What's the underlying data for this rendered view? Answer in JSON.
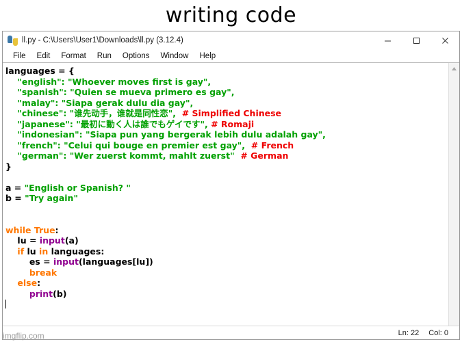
{
  "meme": {
    "caption": "writing code",
    "watermark": "imgflip.com"
  },
  "window": {
    "title": "ll.py - C:\\Users\\User1\\Downloads\\ll.py (3.12.4)",
    "icon": "python-idle-icon",
    "controls": {
      "minimize": "minimize-icon",
      "maximize": "maximize-icon",
      "close": "close-icon"
    }
  },
  "menubar": {
    "items": [
      {
        "label": "File"
      },
      {
        "label": "Edit"
      },
      {
        "label": "Format"
      },
      {
        "label": "Run"
      },
      {
        "label": "Options"
      },
      {
        "label": "Window"
      },
      {
        "label": "Help"
      }
    ]
  },
  "editor": {
    "lines": [
      {
        "indent": 0,
        "segments": [
          {
            "t": "languages = {",
            "c": "def"
          }
        ]
      },
      {
        "indent": 4,
        "segments": [
          {
            "t": "\"english\": \"Whoever moves first is gay\",",
            "c": "str"
          }
        ]
      },
      {
        "indent": 4,
        "segments": [
          {
            "t": "\"spanish\": \"Quien se mueva primero es gay\",",
            "c": "str"
          }
        ]
      },
      {
        "indent": 4,
        "segments": [
          {
            "t": "\"malay\": \"Siapa gerak dulu dia gay\",",
            "c": "str"
          }
        ]
      },
      {
        "indent": 4,
        "segments": [
          {
            "t": "\"chinese\": \"谁先动手，谁就是同性恋\",",
            "c": "str"
          },
          {
            "t": "  ",
            "c": "def"
          },
          {
            "t": "# Simplified Chinese",
            "c": "cmt"
          }
        ]
      },
      {
        "indent": 4,
        "segments": [
          {
            "t": "\"japanese\": \"最初に動く人は誰でもゲイです\",",
            "c": "str"
          },
          {
            "t": " ",
            "c": "def"
          },
          {
            "t": "# Romaji",
            "c": "cmt"
          }
        ]
      },
      {
        "indent": 4,
        "segments": [
          {
            "t": "\"indonesian\": \"Siapa pun yang bergerak lebih dulu adalah gay\",",
            "c": "str"
          }
        ]
      },
      {
        "indent": 4,
        "segments": [
          {
            "t": "\"french\": \"Celui qui bouge en premier est gay\",",
            "c": "str"
          },
          {
            "t": "  ",
            "c": "def"
          },
          {
            "t": "# French",
            "c": "cmt"
          }
        ]
      },
      {
        "indent": 4,
        "segments": [
          {
            "t": "\"german\": \"Wer zuerst kommt, mahlt zuerst\"",
            "c": "str"
          },
          {
            "t": "  ",
            "c": "def"
          },
          {
            "t": "# German",
            "c": "cmt"
          }
        ]
      },
      {
        "indent": 0,
        "segments": [
          {
            "t": "}",
            "c": "def"
          }
        ]
      },
      {
        "indent": 0,
        "segments": []
      },
      {
        "indent": 0,
        "segments": [
          {
            "t": "a = ",
            "c": "def"
          },
          {
            "t": "\"English or Spanish? \"",
            "c": "str"
          }
        ]
      },
      {
        "indent": 0,
        "segments": [
          {
            "t": "b = ",
            "c": "def"
          },
          {
            "t": "\"Try again\"",
            "c": "str"
          }
        ]
      },
      {
        "indent": 0,
        "segments": []
      },
      {
        "indent": 0,
        "segments": []
      },
      {
        "indent": 0,
        "segments": [
          {
            "t": "while True",
            "c": "kw"
          },
          {
            "t": ":",
            "c": "def"
          }
        ]
      },
      {
        "indent": 4,
        "segments": [
          {
            "t": "lu = ",
            "c": "def"
          },
          {
            "t": "input",
            "c": "bi"
          },
          {
            "t": "(a)",
            "c": "def"
          }
        ]
      },
      {
        "indent": 4,
        "segments": [
          {
            "t": "if",
            "c": "kw"
          },
          {
            "t": " lu ",
            "c": "def"
          },
          {
            "t": "in",
            "c": "kw"
          },
          {
            "t": " languages:",
            "c": "def"
          }
        ]
      },
      {
        "indent": 8,
        "segments": [
          {
            "t": "es = ",
            "c": "def"
          },
          {
            "t": "input",
            "c": "bi"
          },
          {
            "t": "(languages[lu])",
            "c": "def"
          }
        ]
      },
      {
        "indent": 8,
        "segments": [
          {
            "t": "break",
            "c": "kw"
          }
        ]
      },
      {
        "indent": 4,
        "segments": [
          {
            "t": "else",
            "c": "kw"
          },
          {
            "t": ":",
            "c": "def"
          }
        ]
      },
      {
        "indent": 8,
        "segments": [
          {
            "t": "print",
            "c": "bi"
          },
          {
            "t": "(b)",
            "c": "def"
          }
        ]
      },
      {
        "indent": 0,
        "segments": [],
        "caret": true
      }
    ],
    "scrollbar": {
      "up_arrow": "chevron-up-icon"
    }
  },
  "statusbar": {
    "line_label": "Ln: 22",
    "col_label": "Col: 0"
  },
  "colors": {
    "string": "#00a000",
    "comment": "#ee0000",
    "keyword": "#ff7700",
    "builtin": "#900090",
    "text": "#000000",
    "background": "#ffffff"
  }
}
